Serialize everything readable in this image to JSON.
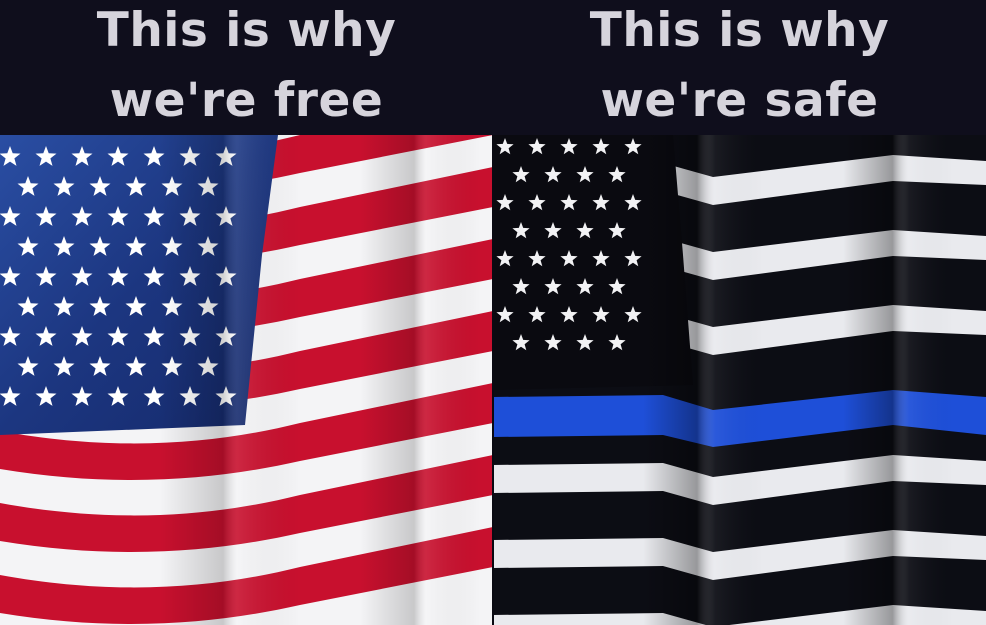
{
  "captions": {
    "left": {
      "line1": "This is why",
      "line2": "we're free"
    },
    "right": {
      "line1": "This is why",
      "line2": "we're safe"
    }
  },
  "images": {
    "left": {
      "subject": "us-flag-image"
    },
    "right": {
      "subject": "thin-blue-line-flag-image"
    }
  },
  "colors": {
    "background": "#0f0e1c",
    "caption_text": "#d6d4dc",
    "flag_red": "#c8102e",
    "flag_white": "#f4f4f6",
    "flag_blue_canton": "#1f3d8a",
    "thin_blue_line": "#1e4fd8",
    "black_stripe": "#0c0d14"
  }
}
